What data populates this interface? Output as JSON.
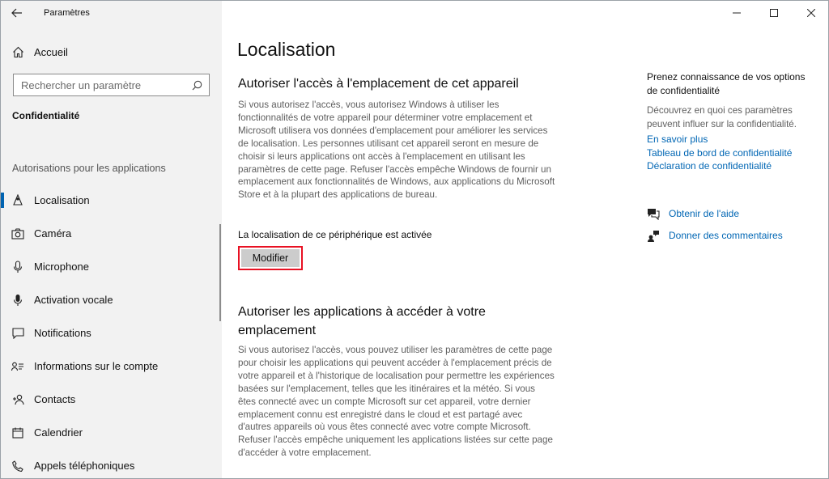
{
  "window": {
    "title": "Paramètres"
  },
  "sidebar": {
    "home_label": "Accueil",
    "search_placeholder": "Rechercher un paramètre",
    "section_title": "Confidentialité",
    "group_title": "Autorisations pour les applications",
    "items": [
      {
        "label": "Localisation",
        "icon": "location-icon",
        "active": true
      },
      {
        "label": "Caméra",
        "icon": "camera-icon"
      },
      {
        "label": "Microphone",
        "icon": "microphone-icon"
      },
      {
        "label": "Activation vocale",
        "icon": "voice-activation-icon"
      },
      {
        "label": "Notifications",
        "icon": "notifications-icon"
      },
      {
        "label": "Informations sur le compte",
        "icon": "account-info-icon"
      },
      {
        "label": "Contacts",
        "icon": "contacts-icon"
      },
      {
        "label": "Calendrier",
        "icon": "calendar-icon"
      },
      {
        "label": "Appels téléphoniques",
        "icon": "phone-calls-icon"
      }
    ]
  },
  "main": {
    "page_title": "Localisation",
    "section1": {
      "heading": "Autoriser l'accès à l'emplacement de cet appareil",
      "body": "Si vous autorisez l'accès, vous autorisez Windows à utiliser les fonctionnalités de votre appareil pour déterminer votre emplacement et Microsoft utilisera vos données d'emplacement pour améliorer les services de localisation. Les personnes utilisant cet appareil seront en mesure de choisir si leurs applications ont accès à l'emplacement en utilisant les paramètres de cette page. Refuser l'accès empêche Windows de fournir un emplacement aux fonctionnalités de Windows, aux applications du Microsoft Store et à la plupart des applications de bureau.",
      "status": "La localisation de ce périphérique est activée",
      "button_label": "Modifier"
    },
    "section2": {
      "heading": "Autoriser les applications à accéder à votre emplacement",
      "body": "Si vous autorisez l'accès, vous pouvez utiliser les paramètres de cette page pour choisir les applications qui peuvent accéder à l'emplacement précis de votre appareil et à l'historique de localisation pour permettre les expériences basées sur l'emplacement, telles que les itinéraires et la météo. Si vous êtes connecté avec un compte Microsoft sur cet appareil, votre dernier emplacement connu est enregistré dans le cloud et est partagé avec d'autres appareils où vous êtes connecté avec votre compte Microsoft. Refuser l'accès empêche uniquement les applications listées sur cette page d'accéder à votre emplacement."
    }
  },
  "right_panel": {
    "heading": "Prenez connaissance de vos options de confidentialité",
    "description": "Découvrez en quoi ces paramètres peuvent influer sur la confidentialité.",
    "links": [
      "En savoir plus",
      "Tableau de bord de confidentialité",
      "Déclaration de confidentialité"
    ],
    "help_label": "Obtenir de l'aide",
    "feedback_label": "Donner des commentaires"
  },
  "colors": {
    "accent": "#0063b1",
    "link": "#0066b4",
    "highlight": "#e81123"
  }
}
